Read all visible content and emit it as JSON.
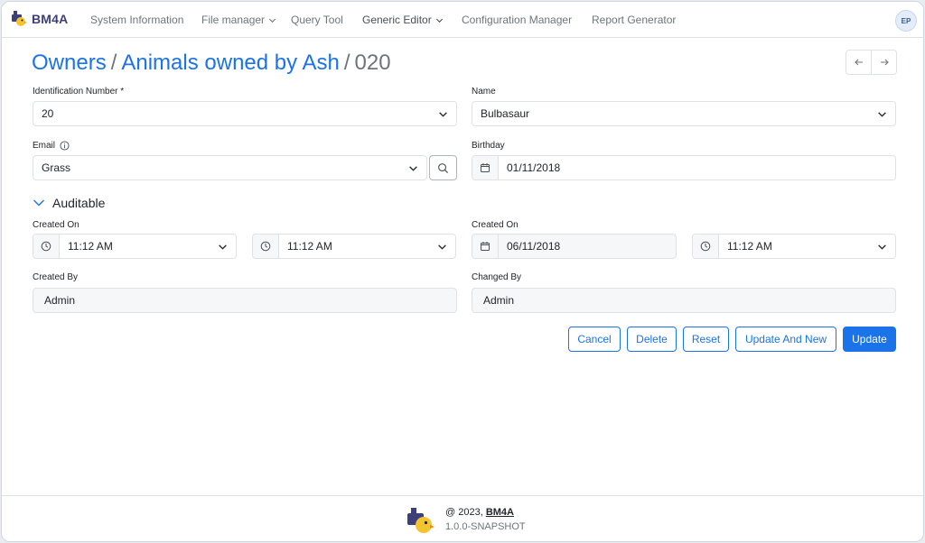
{
  "navbar": {
    "brand": "BM4A",
    "items": [
      {
        "label": "System Information"
      },
      {
        "label": "File manager"
      },
      {
        "label": "Query Tool"
      },
      {
        "label": "Generic Editor"
      },
      {
        "label": "Configuration Manager"
      },
      {
        "label": "Report Generator"
      }
    ],
    "avatar_initials": "EP"
  },
  "title": {
    "crumb1": "Owners",
    "separator": "/",
    "crumb2": "Animals owned by Ash",
    "current": "020"
  },
  "form": {
    "identification_number": {
      "label": "Identification Number *",
      "value": "20"
    },
    "name": {
      "label": "Name",
      "value": "Bulbasaur"
    },
    "email": {
      "label": "Email",
      "value": "Grass"
    },
    "birthday": {
      "label": "Birthday",
      "value": "01/11/2018"
    },
    "section_title": "Auditable",
    "created_on_left": {
      "label": "Created On",
      "time1": "11:12 AM",
      "time2": "11:12 AM"
    },
    "created_on_right": {
      "label": "Created On",
      "date": "06/11/2018",
      "time": "11:12 AM"
    },
    "created_by": {
      "label": "Created By",
      "value": "Admin"
    },
    "changed_by": {
      "label": "Changed By",
      "value": "Admin"
    }
  },
  "actions": {
    "cancel": "Cancel",
    "delete": "Delete",
    "reset": "Reset",
    "update_and_new": "Update And New",
    "update": "Update"
  },
  "footer": {
    "copyright_prefix": "@ 2023, ",
    "copyright_link": "BM4A",
    "version": "1.0.0-SNAPSHOT"
  },
  "colors": {
    "primary": "#1a73e8",
    "brand": "#3c3f7a",
    "muted": "#6c757d"
  }
}
